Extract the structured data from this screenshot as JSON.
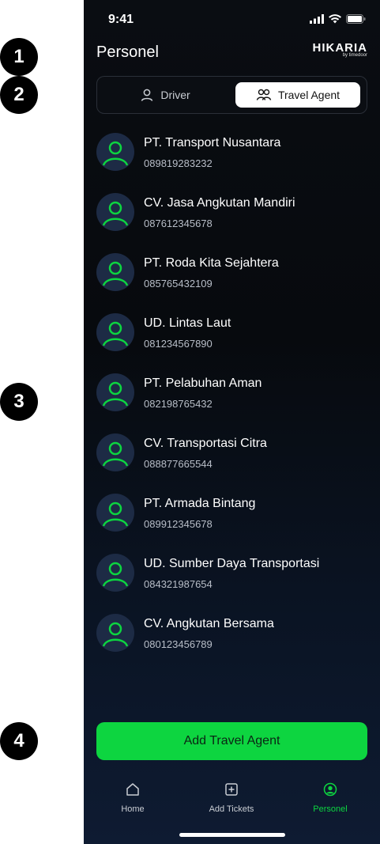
{
  "callouts": [
    "1",
    "2",
    "3",
    "4"
  ],
  "status_bar": {
    "time": "9:41"
  },
  "header": {
    "title": "Personel",
    "logo_text": "HIKARIA",
    "logo_sub": "by timedoor"
  },
  "tabs": [
    {
      "label": "Driver",
      "selected": false
    },
    {
      "label": "Travel Agent",
      "selected": true
    }
  ],
  "agents": [
    {
      "name": "PT. Transport Nusantara",
      "phone": "089819283232"
    },
    {
      "name": "CV. Jasa Angkutan Mandiri",
      "phone": "087612345678"
    },
    {
      "name": "PT. Roda Kita Sejahtera",
      "phone": "085765432109"
    },
    {
      "name": "UD. Lintas Laut",
      "phone": "081234567890"
    },
    {
      "name": "PT. Pelabuhan Aman",
      "phone": "082198765432"
    },
    {
      "name": "CV. Transportasi Citra",
      "phone": "088877665544"
    },
    {
      "name": "PT. Armada Bintang",
      "phone": "089912345678"
    },
    {
      "name": "UD. Sumber Daya Transportasi",
      "phone": "084321987654"
    },
    {
      "name": "CV. Angkutan Bersama",
      "phone": "080123456789"
    }
  ],
  "add_button": {
    "label": "Add Travel Agent"
  },
  "bottom_nav": [
    {
      "label": "Home",
      "icon": "home-icon",
      "active": false
    },
    {
      "label": "Add Tickets",
      "icon": "add-ticket-icon",
      "active": false
    },
    {
      "label": "Personel",
      "icon": "person-icon",
      "active": true
    }
  ],
  "colors": {
    "accent": "#0dd540",
    "avatar_bg": "#1d2b45",
    "inactive_nav": "#c9cdd3"
  }
}
